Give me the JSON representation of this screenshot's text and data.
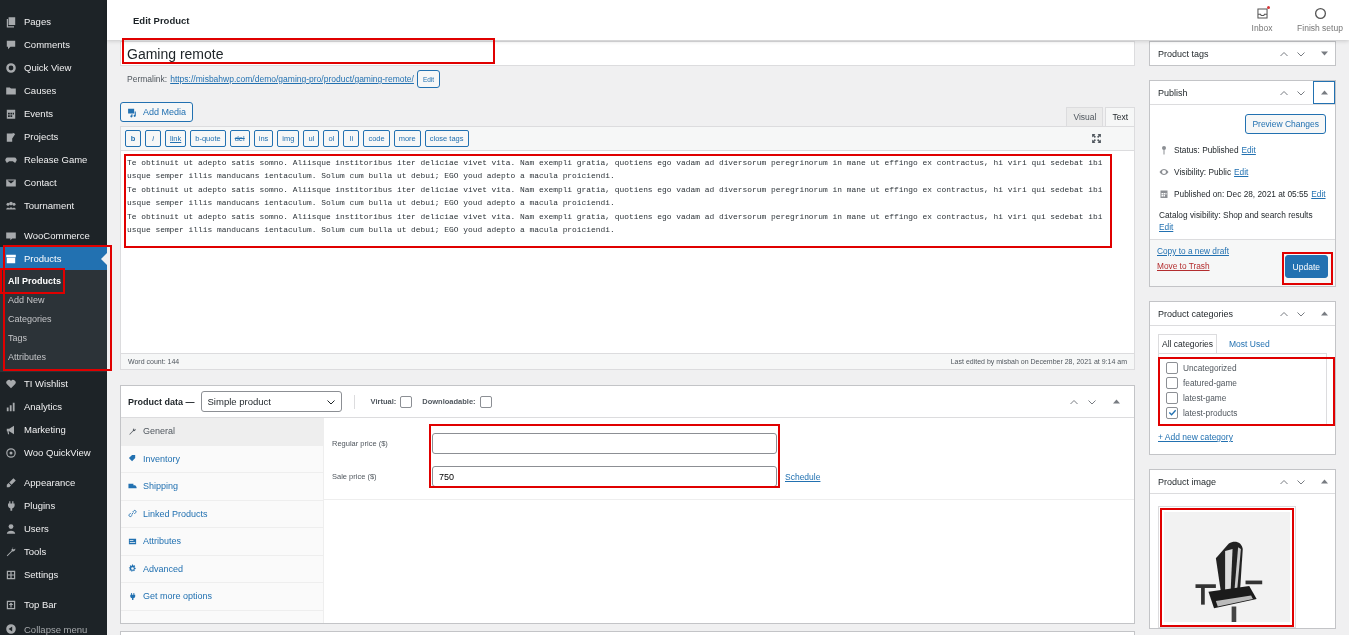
{
  "sidebar": {
    "groups": [
      [
        {
          "label": "Pages",
          "current": false,
          "highlighted": false
        },
        {
          "label": "Comments",
          "current": false,
          "highlighted": false
        },
        {
          "label": "Quick View",
          "current": false,
          "highlighted": false
        },
        {
          "label": "Causes",
          "current": false,
          "highlighted": false
        },
        {
          "label": "Events",
          "current": false,
          "highlighted": false
        },
        {
          "label": "Projects",
          "current": false,
          "highlighted": false
        },
        {
          "label": "Release Game",
          "current": false,
          "highlighted": false
        },
        {
          "label": "Contact",
          "current": false,
          "highlighted": false
        },
        {
          "label": "Tournament",
          "current": false,
          "highlighted": false
        }
      ],
      [
        {
          "label": "WooCommerce",
          "current": false,
          "highlighted": false
        },
        {
          "label": "Products",
          "current": true,
          "highlighted": true,
          "children": [
            {
              "label": "All Products",
              "selected": true,
              "highlighted": true
            },
            {
              "label": "Add New",
              "selected": false,
              "highlighted": false
            },
            {
              "label": "Categories",
              "selected": false,
              "highlighted": false
            },
            {
              "label": "Tags",
              "selected": false,
              "highlighted": false
            },
            {
              "label": "Attributes",
              "selected": false,
              "highlighted": false
            }
          ]
        },
        {
          "label": "TI Wishlist",
          "current": false,
          "highlighted": false
        },
        {
          "label": "Analytics",
          "current": false,
          "highlighted": false
        },
        {
          "label": "Marketing",
          "current": false,
          "highlighted": false
        },
        {
          "label": "Woo QuickView",
          "current": false,
          "highlighted": false
        }
      ],
      [
        {
          "label": "Appearance",
          "current": false,
          "highlighted": false
        },
        {
          "label": "Plugins",
          "current": false,
          "highlighted": false
        },
        {
          "label": "Users",
          "current": false,
          "highlighted": false
        },
        {
          "label": "Tools",
          "current": false,
          "highlighted": false
        },
        {
          "label": "Settings",
          "current": false,
          "highlighted": false
        }
      ],
      [
        {
          "label": "Top Bar",
          "current": false,
          "highlighted": false
        }
      ]
    ],
    "collapse_label": "Collapse menu"
  },
  "header": {
    "title": "Edit Product",
    "actions": [
      {
        "label": "Inbox",
        "notification": true
      },
      {
        "label": "Finish setup",
        "notification": false
      }
    ]
  },
  "post": {
    "title": "Gaming remote",
    "title_highlighted": true,
    "permalink_label": "Permalink:",
    "permalink_url": "https://misbahwp.com/demo/gaming-pro/product/gaming-remote/",
    "permalink_edit": "Edit"
  },
  "editor": {
    "add_media": "Add Media",
    "tabs": [
      {
        "label": "Visual",
        "selected": false
      },
      {
        "label": "Text",
        "selected": true
      }
    ],
    "quicktags": [
      {
        "label": "b",
        "kind": "bold"
      },
      {
        "label": "i",
        "kind": "italic"
      },
      {
        "label": "link",
        "kind": "link"
      },
      {
        "label": "b-quote",
        "kind": "plain"
      },
      {
        "label": "del",
        "kind": "strike"
      },
      {
        "label": "ins",
        "kind": "plain"
      },
      {
        "label": "img",
        "kind": "plain"
      },
      {
        "label": "ul",
        "kind": "plain"
      },
      {
        "label": "ol",
        "kind": "plain"
      },
      {
        "label": "li",
        "kind": "plain"
      },
      {
        "label": "code",
        "kind": "plain"
      },
      {
        "label": "more",
        "kind": "plain"
      },
      {
        "label": "close tags",
        "kind": "plain"
      }
    ],
    "content": {
      "highlighted": true,
      "lines": [
        "Te obtinuit ut adepto satis somno. Aliisque institoribus iter deliciae vivet vita. Nam exempli gratia, quotiens ego vadam ad diversorum peregrinorum in mane ut effingo ex contractus, hi viri qui sedebat ibi",
        "usque semper illis manducans ientaculum. Solum cum bulla ut debui; EGO youd adepto a macula proiciendi.",
        "Te obtinuit ut adepto satis somno. Aliisque institoribus iter deliciae vivet vita. Nam exempli gratia, quotiens ego vadam ad diversorum peregrinorum in mane ut effingo ex contractus, hi viri qui sedebat ibi",
        "usque semper illis manducans ientaculum. Solum cum bulla ut debui; EGO youd adepto a macula proiciendi.",
        "Te obtinuit ut adepto satis somno. Aliisque institoribus iter deliciae vivet vita. Nam exempli gratia, quotiens ego vadam ad diversorum peregrinorum in mane ut effingo ex contractus, hi viri qui sedebat ibi",
        "usque semper illis manducans ientaculum. Solum cum bulla ut debui; EGO youd adepto a macula proiciendi."
      ]
    },
    "word_count": "Word count: 144",
    "last_edited": "Last edited by misbah on December 28, 2021 at 9:14 am"
  },
  "product_data": {
    "label": "Product data —",
    "type_select": "Simple product",
    "options": [
      {
        "label": "Virtual:",
        "checked": false
      },
      {
        "label": "Downloadable:",
        "checked": false
      }
    ],
    "tabs": [
      {
        "label": "General",
        "selected": true
      },
      {
        "label": "Inventory",
        "selected": false
      },
      {
        "label": "Shipping",
        "selected": false
      },
      {
        "label": "Linked Products",
        "selected": false
      },
      {
        "label": "Attributes",
        "selected": false
      },
      {
        "label": "Advanced",
        "selected": false
      },
      {
        "label": "Get more options",
        "selected": false
      }
    ],
    "fields": [
      {
        "label": "Regular price ($)"
      },
      {
        "label": "Sale price ($)",
        "value": "750",
        "link": "Schedule"
      }
    ],
    "fields_highlighted": true
  },
  "tags_box": {
    "title": "Product tags",
    "expanded": false
  },
  "publish_box": {
    "title": "Publish",
    "expanded": true,
    "toggle_focused": true,
    "preview": "Preview Changes",
    "rows": [
      {
        "text": "Status: Published",
        "link": "Edit"
      },
      {
        "text": "Visibility: Public",
        "link": "Edit"
      },
      {
        "text": "Published on: Dec 28, 2021 at 05:55",
        "link": "Edit"
      },
      {
        "text": "Catalog visibility: Shop and search results",
        "link": "Edit"
      }
    ],
    "copy_link": "Copy to a new draft",
    "trash_link": "Move to Trash",
    "update": "Update",
    "update_highlighted": true
  },
  "categories_box": {
    "title": "Product categories",
    "expanded": true,
    "tabs": [
      {
        "label": "All categories",
        "selected": true
      },
      {
        "label": "Most Used",
        "selected": false
      }
    ],
    "items": [
      {
        "label": "Uncategorized",
        "checked": false
      },
      {
        "label": "featured-game",
        "checked": false
      },
      {
        "label": "latest-game",
        "checked": false
      },
      {
        "label": "latest-products",
        "checked": true
      }
    ],
    "list_highlighted": true,
    "add_link": "+ Add new category"
  },
  "image_box": {
    "title": "Product image",
    "expanded": true,
    "image_highlighted": true
  }
}
